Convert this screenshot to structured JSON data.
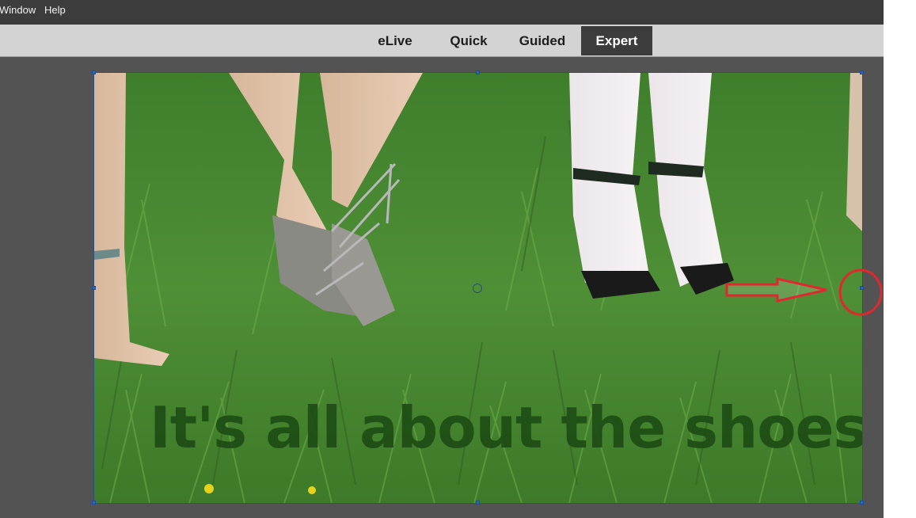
{
  "menubar": {
    "items": [
      {
        "label": "Window"
      },
      {
        "label": "Help"
      }
    ]
  },
  "modes": {
    "tabs": [
      {
        "label": "eLive",
        "active": false
      },
      {
        "label": "Quick",
        "active": false
      },
      {
        "label": "Guided",
        "active": false
      },
      {
        "label": "Expert",
        "active": true
      }
    ]
  },
  "canvas": {
    "text_layer": "It's all about the shoes",
    "text_color": "#1e4d14"
  },
  "annotation": {
    "color": "#e0282e",
    "icons": [
      "arrow-right-icon",
      "circle-highlight-icon"
    ]
  },
  "colors": {
    "menubar": "#3c3c3c",
    "modebar": "#d3d3d3",
    "workspace": "#535353",
    "active_tab": "#3c3c3c",
    "selection_handle": "#2a66c8"
  }
}
